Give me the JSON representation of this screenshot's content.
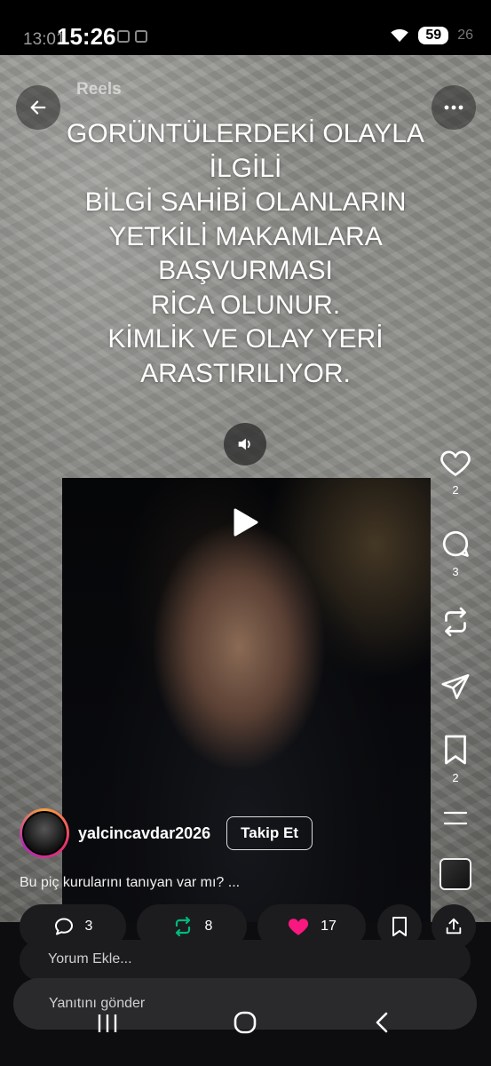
{
  "status_bar": {
    "time_secondary": "13:01",
    "time": "15:26",
    "battery": "59",
    "secondary_percent": "26"
  },
  "header": {
    "title": "Reels"
  },
  "overlay_text": [
    "GORÜNTÜLERDEKİ OLAYLA",
    "İLGİLİ",
    "BİLGİ SAHİBİ OLANLARIN",
    "YETKİLİ MAKAMLARA",
    "BAŞVURMASI",
    "RİCA OLUNUR.",
    "KİMLİK VE OLAY YERİ",
    "ARASTIRILIYOR."
  ],
  "rail": {
    "likes": "2",
    "comments": "3",
    "bookmarks": "2"
  },
  "author": {
    "username": "yalcincavdar2026",
    "follow_label": "Takip Et"
  },
  "caption": "Bu piç kurularını tanıyan var mı? ...",
  "action_bar": {
    "replies": "3",
    "reposts": "8",
    "likes": "17"
  },
  "reply_placeholder": "Yorum Ekle...",
  "send_placeholder": "Yanıtını gönder",
  "colors": {
    "repost_green": "#00ba7c",
    "like_pink": "#f91880",
    "pill_bg": "#1c1c1e"
  }
}
